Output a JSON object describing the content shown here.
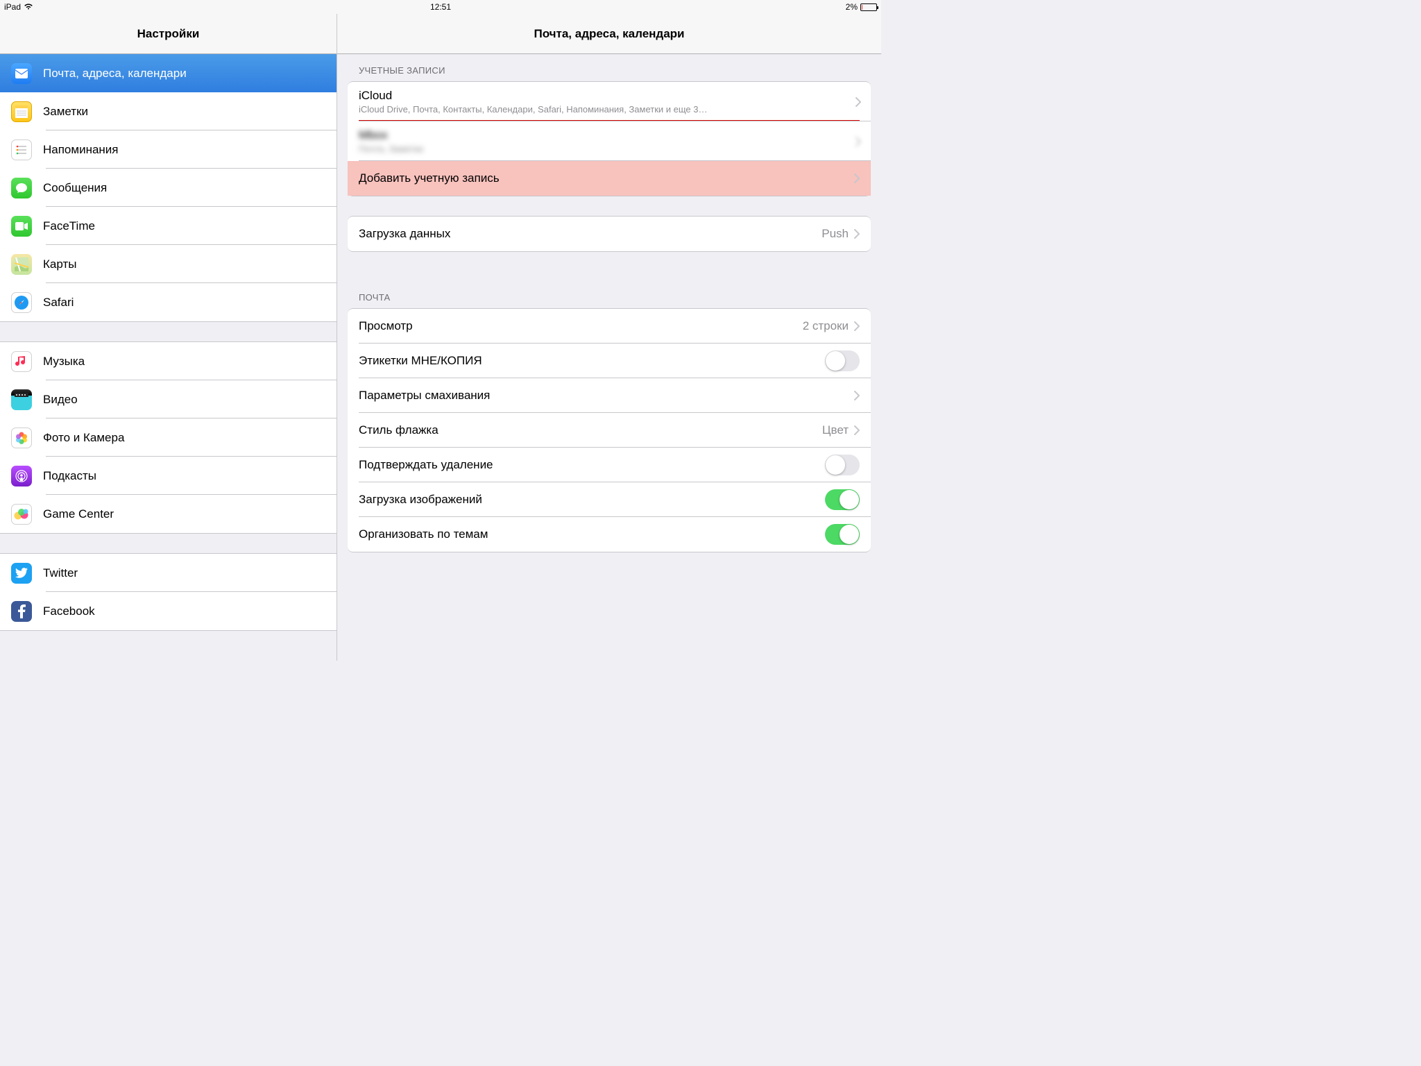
{
  "status": {
    "device": "iPad",
    "time": "12:51",
    "battery": "2%"
  },
  "sidebar": {
    "title": "Настройки",
    "groupA": [
      {
        "label": "Почта, адреса, календари",
        "iconClass": "ic-mail",
        "icon": "mail-icon",
        "selected": true
      },
      {
        "label": "Заметки",
        "iconClass": "ic-notes",
        "icon": "notes-icon"
      },
      {
        "label": "Напоминания",
        "iconClass": "ic-reminders",
        "icon": "reminders-icon"
      },
      {
        "label": "Сообщения",
        "iconClass": "ic-messages",
        "icon": "messages-icon"
      },
      {
        "label": "FaceTime",
        "iconClass": "ic-facetime",
        "icon": "facetime-icon"
      },
      {
        "label": "Карты",
        "iconClass": "ic-maps",
        "icon": "maps-icon"
      },
      {
        "label": "Safari",
        "iconClass": "ic-safari",
        "icon": "safari-icon"
      }
    ],
    "groupB": [
      {
        "label": "Музыка",
        "iconClass": "ic-music",
        "icon": "music-icon"
      },
      {
        "label": "Видео",
        "iconClass": "ic-video",
        "icon": "video-icon"
      },
      {
        "label": "Фото и Камера",
        "iconClass": "ic-photos",
        "icon": "photos-icon"
      },
      {
        "label": "Подкасты",
        "iconClass": "ic-podcasts",
        "icon": "podcasts-icon"
      },
      {
        "label": "Game Center",
        "iconClass": "ic-gamecenter",
        "icon": "gamecenter-icon"
      }
    ],
    "groupC": [
      {
        "label": "Twitter",
        "iconClass": "ic-twitter",
        "icon": "twitter-icon"
      },
      {
        "label": "Facebook",
        "iconClass": "ic-facebook",
        "icon": "facebook-icon"
      }
    ]
  },
  "detail": {
    "title": "Почта, адреса, календари",
    "accounts_header": "УЧЕТНЫЕ ЗАПИСИ",
    "accounts": {
      "icloud_title": "iCloud",
      "icloud_sub": "iCloud Drive, Почта, Контакты, Календари, Safari, Напоминания, Заметки и еще 3…",
      "blur_title": "Mbox",
      "blur_sub": "Почта, Заметки",
      "add": "Добавить учетную запись"
    },
    "fetch": {
      "label": "Загрузка данных",
      "value": "Push"
    },
    "mail_header": "ПОЧТА",
    "mail": {
      "preview_label": "Просмотр",
      "preview_value": "2 строки",
      "cc_label": "Этикетки МНЕ/КОПИЯ",
      "swipe_label": "Параметры смахивания",
      "flag_label": "Стиль флажка",
      "flag_value": "Цвет",
      "confirm_label": "Подтверждать удаление",
      "images_label": "Загрузка изображений",
      "thread_label": "Организовать по темам"
    }
  },
  "toggles": {
    "cc": false,
    "confirm": false,
    "images": true,
    "thread": true
  }
}
